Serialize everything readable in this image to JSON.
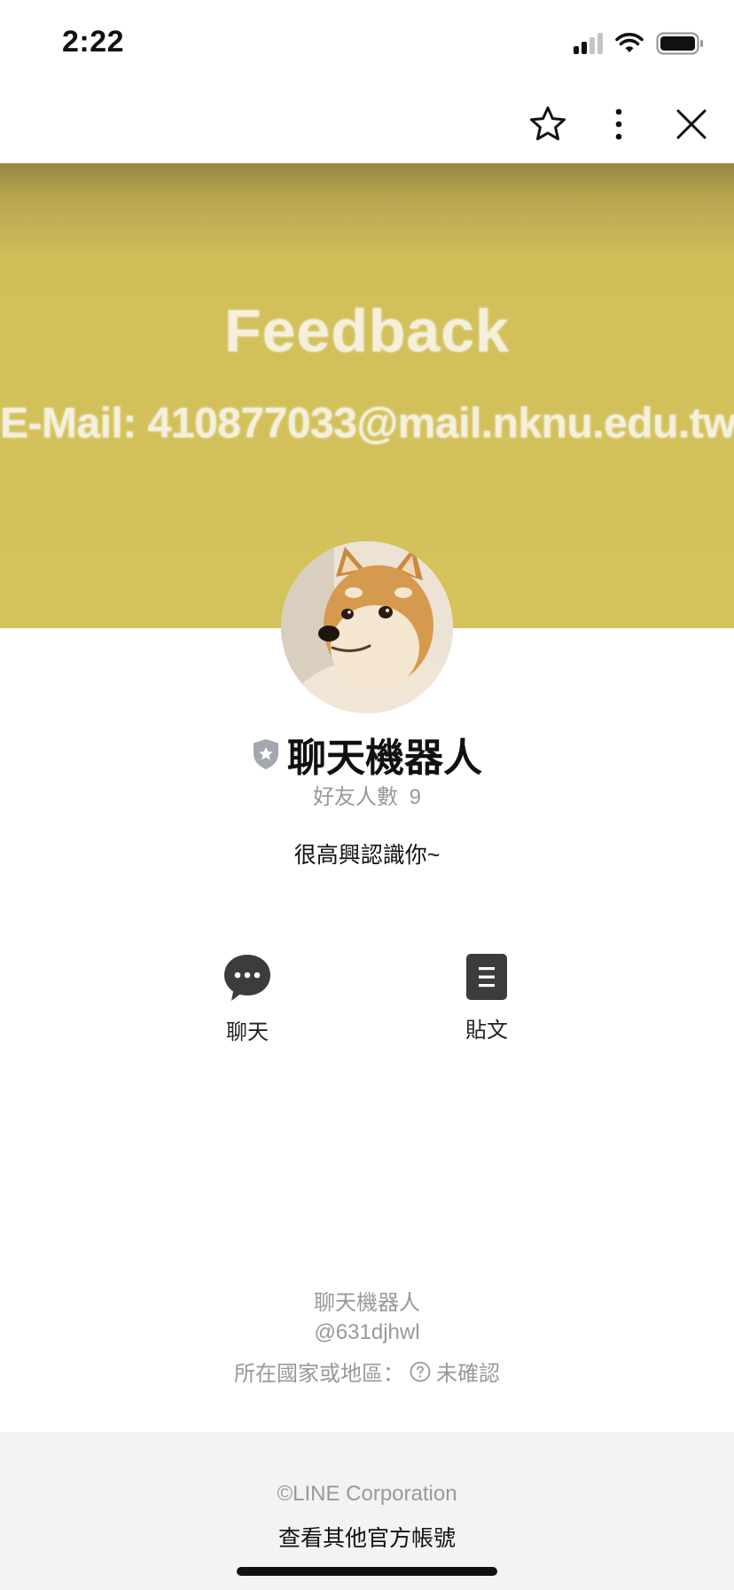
{
  "status_bar": {
    "time": "2:22"
  },
  "cover": {
    "title": "Feedback",
    "email": "E-Mail: 410877033@mail.nknu.edu.tw"
  },
  "profile": {
    "name": "聊天機器人",
    "friend_count_label": "好友人數",
    "friend_count": "9",
    "status_message": "很高興認識你~"
  },
  "actions": [
    {
      "label": "聊天",
      "icon": "chat-bubble-icon"
    },
    {
      "label": "貼文",
      "icon": "post-icon"
    }
  ],
  "account_info": {
    "name": "聊天機器人",
    "id": "@631djhwl",
    "region_label": "所在國家或地區：",
    "region_value": "未確認"
  },
  "footer": {
    "copyright": "©LINE Corporation",
    "more_link": "查看其他官方帳號"
  },
  "colors": {
    "cover": "#d4c25b",
    "footer_bg": "#f3f3f3",
    "muted_text": "#999999",
    "icon_dark": "#3c3c3f"
  }
}
